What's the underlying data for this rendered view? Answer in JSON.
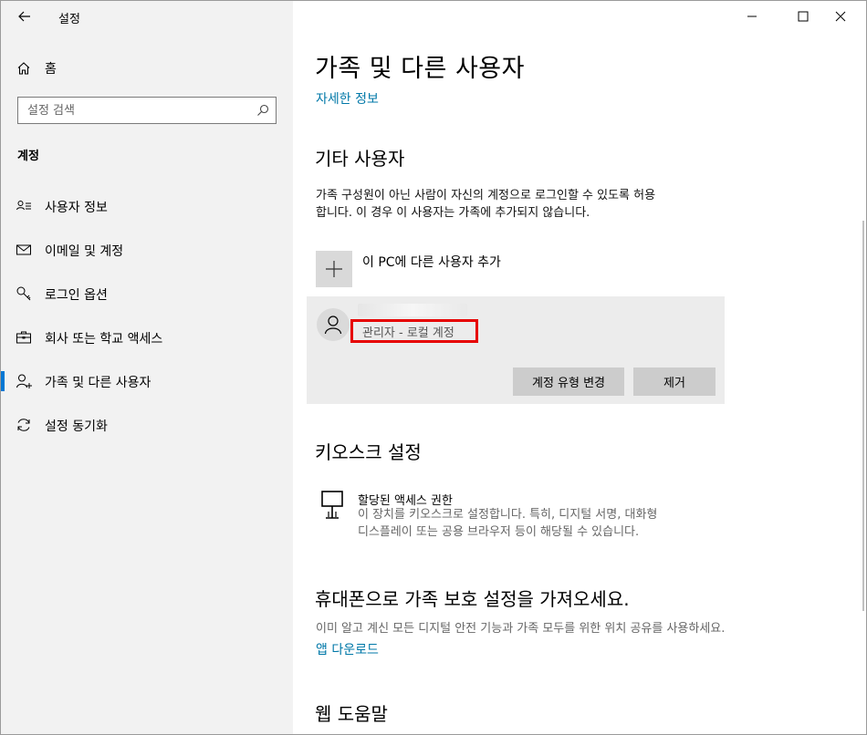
{
  "window": {
    "title": "설정",
    "back_icon": "back-arrow-icon",
    "controls": [
      "minimize-icon",
      "maximize-icon",
      "close-icon"
    ]
  },
  "sidebar": {
    "home_label": "홈",
    "search_placeholder": "설정 검색",
    "section_title": "계정",
    "items": [
      {
        "label": "사용자 정보",
        "icon": "user-info-icon",
        "selected": false
      },
      {
        "label": "이메일 및 계정",
        "icon": "mail-icon",
        "selected": false
      },
      {
        "label": "로그인 옵션",
        "icon": "key-icon",
        "selected": false
      },
      {
        "label": "회사 또는 학교 액세스",
        "icon": "briefcase-icon",
        "selected": false
      },
      {
        "label": "가족 및 다른 사용자",
        "icon": "person-add-icon",
        "selected": true
      },
      {
        "label": "설정 동기화",
        "icon": "sync-icon",
        "selected": false
      }
    ],
    "accent_color": "#0078d4"
  },
  "main": {
    "title": "가족 및 다른 사용자",
    "more_info_link": "자세한 정보",
    "other_users": {
      "heading": "기타 사용자",
      "description_line1": "가족 구성원이 아닌 사람이 자신의 계정으로 로그인할 수 있도록 허용",
      "description_line2": "합니다. 이 경우 이 사용자는 가족에 추가되지 않습니다.",
      "add_label": "이 PC에 다른 사용자 추가",
      "user": {
        "role": "관리자 - 로컬 계정",
        "change_type_button": "계정 유형 변경",
        "remove_button": "제거"
      }
    },
    "kiosk": {
      "heading": "키오스크 설정",
      "item_title": "할당된 액세스 권한",
      "item_desc_line1": "이 장치를 키오스크로 설정합니다. 특히, 디지털 서명, 대화형",
      "item_desc_line2": "디스플레이 또는 공용 브라우저 등이 해당될 수 있습니다."
    },
    "family_safety": {
      "heading": "휴대폰으로 가족 보호 설정을 가져오세요.",
      "description": "이미 알고 계신 모든 디지털 안전 기능과 가족 모두를 위한 위치 공유를 사용하세요.",
      "download_link": "앱 다운로드"
    },
    "web_help": {
      "heading": "웹 도움말"
    },
    "link_color": "#0078a8",
    "highlight_color": "#e60000"
  }
}
